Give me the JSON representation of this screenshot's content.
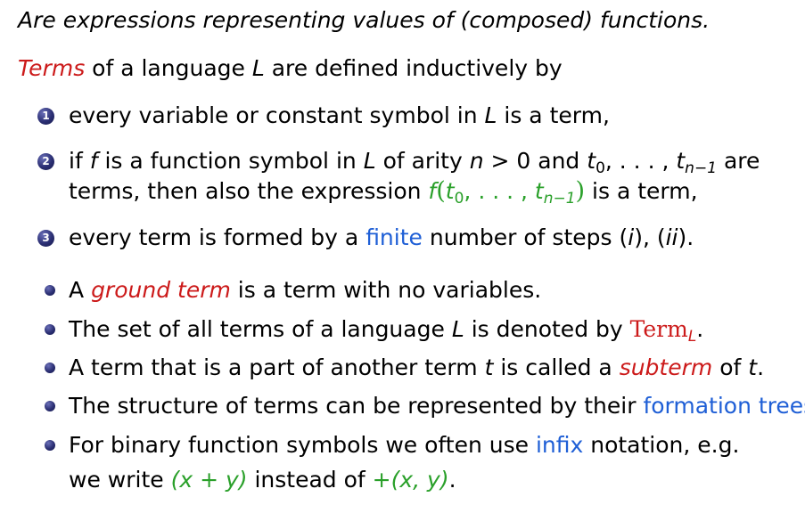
{
  "intro": "Are expressions representing values of (composed) functions.",
  "definition": {
    "term_word": "Terms",
    "rest": " of a language ",
    "L": "L",
    "tail": " are defined inductively by"
  },
  "enumerated": [
    {
      "number": "1",
      "line1_a": "every variable or constant symbol in ",
      "line1_L": "L",
      "line1_b": " is a term,"
    },
    {
      "number": "2",
      "line1_a": "if ",
      "line1_f": "f",
      "line1_b": " is a function symbol in ",
      "line1_L": "L",
      "line1_c": " of arity ",
      "line1_n": "n",
      "line1_d": " > 0 and ",
      "line1_t0": "t",
      "line1_t0sub": "0",
      "line1_e": ", . . . , ",
      "line1_tn": "t",
      "line1_tnsub": "n−1",
      "line1_f2": " are",
      "line2_a": "terms, then also the expression ",
      "line2_expr_f": "f",
      "line2_expr_open": "(",
      "line2_expr_t0": "t",
      "line2_expr_t0sub": "0",
      "line2_expr_mid": ", . . . , ",
      "line2_expr_tn": "t",
      "line2_expr_tnsub": "n−1",
      "line2_expr_close": ")",
      "line2_b": " is a term,"
    },
    {
      "number": "3",
      "line1_a": "every term is formed by a ",
      "line1_finite": "finite",
      "line1_b": " number of steps (",
      "line1_i": "i",
      "line1_c": "), (",
      "line1_ii": "ii",
      "line1_d": ")."
    }
  ],
  "bullets": [
    {
      "a": "A ",
      "em": "ground term",
      "b": " is a term with no variables."
    },
    {
      "a": "The set of all terms of a language ",
      "L": "L",
      "b": " is denoted by ",
      "term": "Term",
      "sub": "L",
      "c": "."
    },
    {
      "a": "A term that is a part of another term ",
      "t": "t",
      "b": " is called a ",
      "em": "subterm",
      "c": " of ",
      "t2": "t",
      "d": "."
    },
    {
      "a": "The structure of terms can be represented by their ",
      "link": "formation trees",
      "b": "."
    },
    {
      "line1_a": "For binary function symbols we often use ",
      "line1_link": "infix",
      "line1_b": " notation, e.g.",
      "line2_a": "we write ",
      "line2_expr1": "(x + y)",
      "line2_b": " instead of ",
      "line2_expr2": "+(x, y)",
      "line2_c": "."
    }
  ],
  "colors": {
    "emphasis_red": "#cc1a1a",
    "link_blue": "#1f5fd6",
    "math_green": "#2aa02a",
    "bullet_navy": "#2b2f73"
  }
}
